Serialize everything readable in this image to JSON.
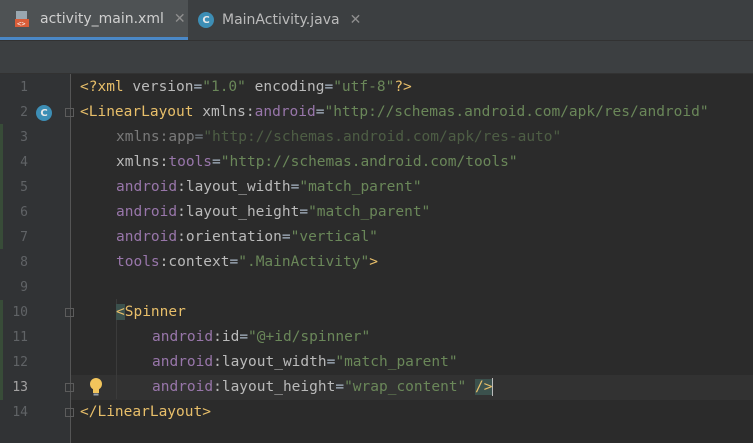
{
  "tabs": [
    {
      "label": "activity_main.xml",
      "icon": "xml-file-icon",
      "active": true
    },
    {
      "label": "MainActivity.java",
      "icon": "java-class-icon",
      "active": false
    }
  ],
  "close_glyph": "✕",
  "class_glyph": "C",
  "line_numbers": [
    "1",
    "2",
    "3",
    "4",
    "5",
    "6",
    "7",
    "8",
    "9",
    "10",
    "11",
    "12",
    "13",
    "14"
  ],
  "code": {
    "l1": {
      "a": "<?xml ",
      "b": "version",
      "c": "=",
      "d": "\"1.0\"",
      "e": " ",
      "f": "encoding",
      "g": "=",
      "h": "\"utf-8\"",
      "i": "?>"
    },
    "l2": {
      "a": "<",
      "b": "LinearLayout",
      "c": " ",
      "d": "xmlns:",
      "e": "android",
      "f": "=",
      "g": "\"http://schemas.android.com/apk/res/android\""
    },
    "l3": {
      "a": "xmlns:app",
      "b": "=",
      "c": "\"http://schemas.android.com/apk/res-auto\""
    },
    "l4": {
      "a": "xmlns:",
      "b": "tools",
      "c": "=",
      "d": "\"http://schemas.android.com/tools\""
    },
    "l5": {
      "a": "android",
      "b": ":layout_width",
      "c": "=",
      "d": "\"match_parent\""
    },
    "l6": {
      "a": "android",
      "b": ":layout_height",
      "c": "=",
      "d": "\"match_parent\""
    },
    "l7": {
      "a": "android",
      "b": ":orientation",
      "c": "=",
      "d": "\"vertical\""
    },
    "l8": {
      "a": "tools",
      "b": ":context",
      "c": "=",
      "d": "\".MainActivity\"",
      "e": ">"
    },
    "l10": {
      "a": "<",
      "b": "Spinner"
    },
    "l11": {
      "a": "android",
      "b": ":id",
      "c": "=",
      "d": "\"@+id/spinner\""
    },
    "l12": {
      "a": "android",
      "b": ":layout_width",
      "c": "=",
      "d": "\"match_parent\""
    },
    "l13": {
      "a": "android",
      "b": ":layout_height",
      "c": "=",
      "d": "\"wrap_content\"",
      "e": " ",
      "f": "/>"
    },
    "l14": {
      "a": "</",
      "b": "LinearLayout",
      "c": ">"
    }
  },
  "colors": {
    "accent": "#4a88c7",
    "tag": "#e8bf6a",
    "string": "#6a8759",
    "namespace": "#9876aa"
  }
}
